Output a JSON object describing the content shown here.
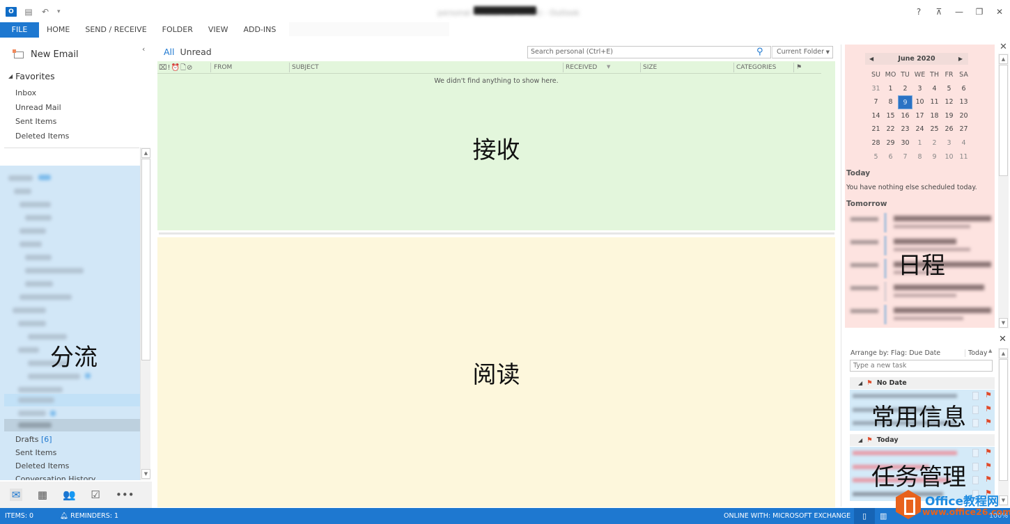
{
  "titlebar": {
    "app_icon": "outlook-icon",
    "quick_access": [
      "send-receive-icon",
      "undo-icon",
      "customize-icon"
    ],
    "window_title": "personal - (redacted email) - Outlook",
    "controls": {
      "help": "?",
      "ribbon_display": "ribbon-display-icon",
      "minimize": "—",
      "restore": "restore-icon",
      "close": "✕"
    }
  },
  "ribbon": {
    "tabs": [
      {
        "label": "FILE",
        "active": true
      },
      {
        "label": "HOME"
      },
      {
        "label": "SEND / RECEIVE"
      },
      {
        "label": "FOLDER"
      },
      {
        "label": "VIEW"
      },
      {
        "label": "ADD-INS"
      }
    ]
  },
  "nav": {
    "collapse": "‹",
    "new_email": "New Email",
    "favorites_header": "Favorites",
    "favorites": [
      "Inbox",
      "Unread Mail",
      "Sent Items",
      "Deleted Items"
    ],
    "overlay_label": "分流",
    "bottom_folders": [
      {
        "label": "Drafts",
        "count": "[6]"
      },
      {
        "label": "Sent Items"
      },
      {
        "label": "Deleted Items"
      },
      {
        "label": "Conversation History"
      }
    ],
    "modules": [
      "mail-icon",
      "calendar-icon",
      "people-icon",
      "tasks-icon",
      "more-icon"
    ]
  },
  "message_list": {
    "filters": {
      "all": "All",
      "unread": "Unread"
    },
    "search": {
      "placeholder": "Search personal (Ctrl+E)",
      "scope": "Current Folder"
    },
    "columns": [
      "FROM",
      "SUBJECT",
      "RECEIVED",
      "SIZE",
      "CATEGORIES"
    ],
    "empty_message": "We didn't find anything to show here.",
    "overlay_label": "接收"
  },
  "reading_pane": {
    "overlay_label": "阅读"
  },
  "calendar": {
    "month": "June 2020",
    "weekdays": [
      "SU",
      "MO",
      "TU",
      "WE",
      "TH",
      "FR",
      "SA"
    ],
    "weeks": [
      [
        "31",
        "1",
        "2",
        "3",
        "4",
        "5",
        "6"
      ],
      [
        "7",
        "8",
        "9",
        "10",
        "11",
        "12",
        "13"
      ],
      [
        "14",
        "15",
        "16",
        "17",
        "18",
        "19",
        "20"
      ],
      [
        "21",
        "22",
        "23",
        "24",
        "25",
        "26",
        "27"
      ],
      [
        "28",
        "29",
        "30",
        "1",
        "2",
        "3",
        "4"
      ],
      [
        "5",
        "6",
        "7",
        "8",
        "9",
        "10",
        "11"
      ]
    ],
    "selected_day": "9",
    "today_header": "Today",
    "today_note": "You have nothing else scheduled today.",
    "tomorrow_header": "Tomorrow",
    "overlay_label": "日程"
  },
  "tasks": {
    "arrange_by": "Arrange by: Flag: Due Date",
    "arrange_group": "Today",
    "new_task_placeholder": "Type a new task",
    "groups": [
      {
        "label": "No Date",
        "count": 3
      },
      {
        "label": "Today",
        "count": 4
      }
    ],
    "overlay_label_1": "常用信息",
    "overlay_label_2": "任务管理"
  },
  "statusbar": {
    "items": "ITEMS: 0",
    "reminders": "REMINDERS: 1",
    "connection": "ONLINE WITH: MICROSOFT EXCHANGE",
    "zoom": "100%"
  },
  "watermark": {
    "title": "Office教程网",
    "url": "www.office26.com"
  },
  "colors": {
    "accent": "#1e78d0",
    "inbox_zone": "#e3f6dc",
    "reading_zone": "#fdf7dc",
    "calendar_zone": "#fde3e0",
    "folder_zone": "#d2e7f7",
    "task_flag": "#e04a2a"
  }
}
